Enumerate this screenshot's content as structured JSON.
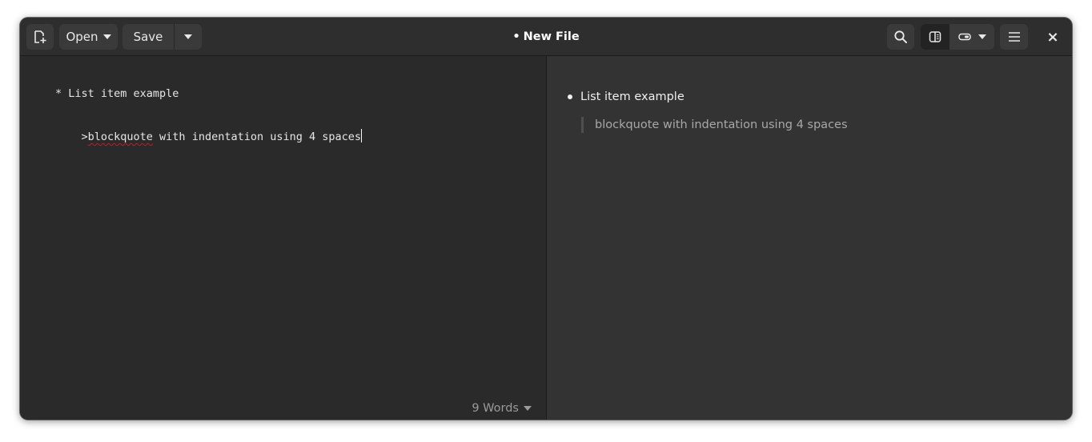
{
  "window": {
    "title": "New File",
    "modified_indicator": "•"
  },
  "toolbar": {
    "new_file_icon": "new-document-icon",
    "open_label": "Open",
    "save_label": "Save",
    "search_icon": "search-icon",
    "view_icons": [
      "split-view-icon",
      "preview-toggle-icon"
    ],
    "menu_icon": "hamburger-menu-icon",
    "close_label": "×"
  },
  "editor": {
    "lines": [
      "* List item example",
      "    >",
      "blockquote",
      " with indentation using 4 spaces"
    ]
  },
  "status": {
    "word_count": "9 Words"
  },
  "preview": {
    "list_item": "List item example",
    "blockquote": "blockquote with indentation using 4 spaces"
  },
  "colors": {
    "window_bg": "#2b2b2b",
    "headerbar_bg": "#2e2e2e",
    "preview_bg": "#333333",
    "button_bg": "#3a3a3a",
    "spell_underline": "#c01c28"
  }
}
